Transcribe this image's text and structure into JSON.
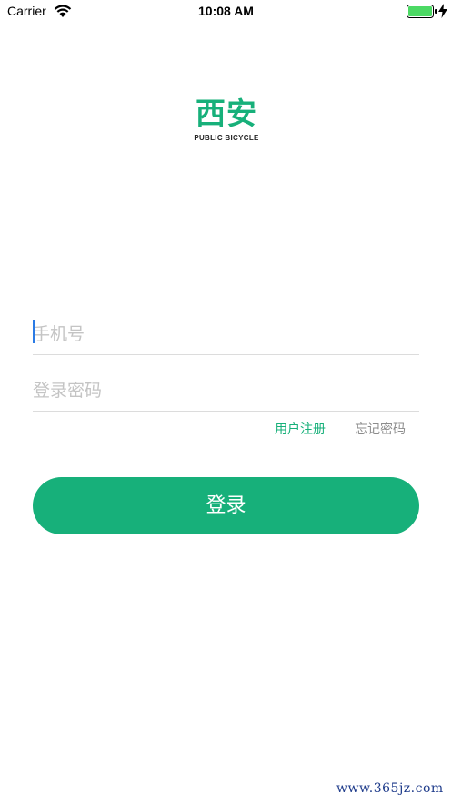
{
  "status_bar": {
    "carrier": "Carrier",
    "time": "10:08 AM",
    "wifi_icon": "wifi-icon",
    "battery_icon": "battery-full-icon",
    "charging_icon": "charging-bolt-icon",
    "battery_color": "#4cd964"
  },
  "logo": {
    "title": "西安",
    "subtitle": "PUBLIC BICYCLE",
    "color": "#17b07a"
  },
  "form": {
    "phone_placeholder": "手机号",
    "phone_value": "",
    "password_placeholder": "登录密码",
    "password_value": "",
    "register_link": "用户注册",
    "forgot_link": "忘记密码",
    "login_button": "登录"
  },
  "colors": {
    "accent": "#17b07a",
    "link_muted": "#8c8c8c",
    "cursor": "#2b7be5"
  },
  "watermark": "www.365jz.com"
}
